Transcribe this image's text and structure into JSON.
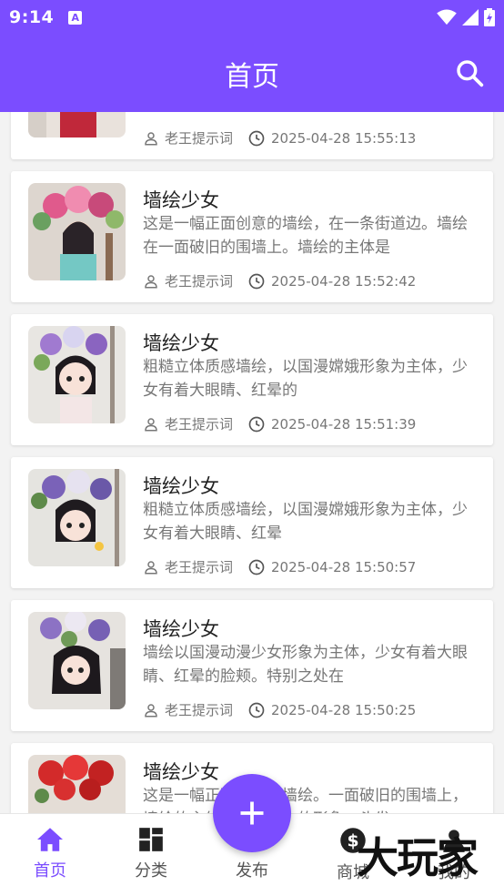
{
  "status_bar": {
    "time": "9:14",
    "notification_icon": "a-icon"
  },
  "header": {
    "title": "首页",
    "search_icon": "search-icon"
  },
  "accent_color": "#7b4dff",
  "posts": [
    {
      "title": "",
      "description": "",
      "author": "老王提示词",
      "timestamp": "2025-04-28 15:55:13"
    },
    {
      "title": "墙绘少女",
      "description": "这是一幅正面创意的墙绘，在一条街道边。墙绘在一面破旧的围墙上。墙绘的主体是",
      "author": "老王提示词",
      "timestamp": "2025-04-28 15:52:42"
    },
    {
      "title": "墙绘少女",
      "description": "粗糙立体质感墙绘，以国漫嫦娥形象为主体，少女有着大眼睛、红晕的",
      "author": "老王提示词",
      "timestamp": "2025-04-28 15:51:39"
    },
    {
      "title": "墙绘少女",
      "description": "粗糙立体质感墙绘，以国漫嫦娥形象为主体，少女有着大眼睛、红晕",
      "author": "老王提示词",
      "timestamp": "2025-04-28 15:50:57"
    },
    {
      "title": "墙绘少女",
      "description": "墙绘以国漫动漫少女形象为主体，少女有着大眼睛、红晕的脸颊。特别之处在",
      "author": "老王提示词",
      "timestamp": "2025-04-28 15:50:25"
    },
    {
      "title": "墙绘少女",
      "description": "这是一幅正面创意的墙绘。一面破旧的围墙上，墙绘的主体是一位少女的形象，头发",
      "author": "",
      "timestamp": ""
    }
  ],
  "bottom_nav": {
    "home": "首页",
    "category": "分类",
    "publish": "发布",
    "shop": "商城",
    "mine": "我的"
  },
  "watermark": "大玩家"
}
